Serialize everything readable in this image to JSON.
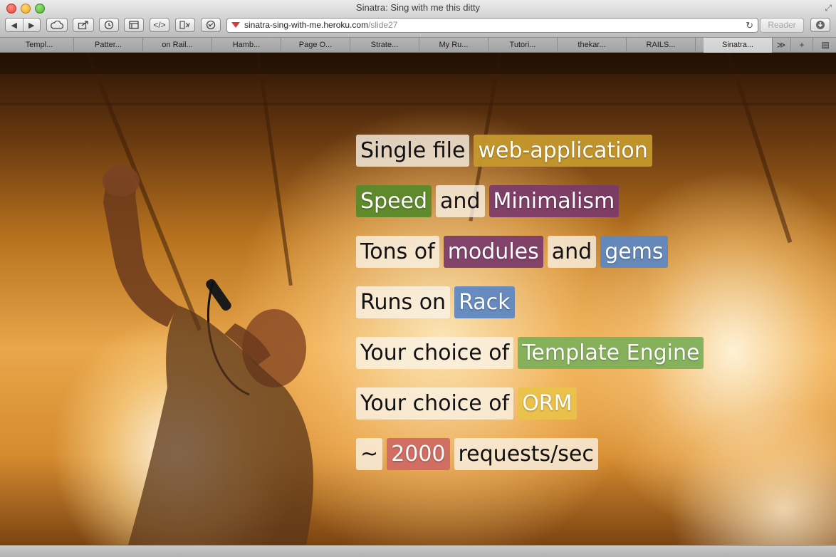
{
  "window": {
    "title": "Sinatra: Sing with me this ditty"
  },
  "toolbar": {
    "back_icon": "back-arrow-icon",
    "forward_icon": "forward-arrow-icon",
    "url_host": "sinatra-sing-with-me.heroku.com",
    "url_path": "/slide27",
    "reader_label": "Reader"
  },
  "tabs": [
    {
      "label": "Templ..."
    },
    {
      "label": "Patter..."
    },
    {
      "label": "on Rail..."
    },
    {
      "label": "Hamb..."
    },
    {
      "label": "Page O..."
    },
    {
      "label": "Strate..."
    },
    {
      "label": "My Ru..."
    },
    {
      "label": "Tutori..."
    },
    {
      "label": "thekar..."
    },
    {
      "label": "RAILS..."
    },
    {
      "label": "Sinatra..."
    }
  ],
  "tabbar": {
    "overflow_label": "≫",
    "add_label": "+"
  },
  "slide": {
    "lines": [
      [
        {
          "text": "Single file"
        },
        {
          "text": "web-application",
          "color": "#c89a2e"
        }
      ],
      [
        {
          "text": "Speed",
          "color": "#5a8a2a"
        },
        {
          "text": "and"
        },
        {
          "text": "Minimalism",
          "color": "#7a3a6a"
        }
      ],
      [
        {
          "text": "Tons of"
        },
        {
          "text": "modules",
          "color": "#7a3a6a"
        },
        {
          "text": "and"
        },
        {
          "text": "gems",
          "color": "#5f88c2"
        }
      ],
      [
        {
          "text": "Runs on"
        },
        {
          "text": "Rack",
          "color": "#5f88c2"
        }
      ],
      [
        {
          "text": "Your choice of"
        },
        {
          "text": "Template Engine",
          "color": "#7fb05a"
        }
      ],
      [
        {
          "text": "Your choice of"
        },
        {
          "text": "ORM",
          "color": "#e9c24a"
        }
      ],
      [
        {
          "text": "~"
        },
        {
          "text": "2000",
          "color": "#d06a62"
        },
        {
          "text": "requests/sec"
        }
      ]
    ]
  }
}
